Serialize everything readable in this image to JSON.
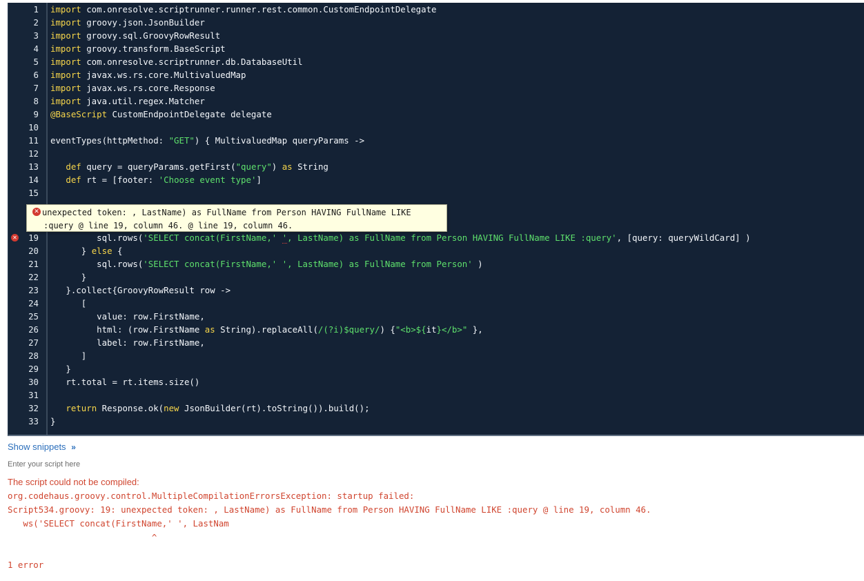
{
  "editor": {
    "lines": [
      {
        "n": "1",
        "segs": [
          {
            "t": "import",
            "c": "kw"
          },
          {
            "t": " com.onresolve.scriptrunner.runner.rest.common.CustomEndpointDelegate"
          }
        ]
      },
      {
        "n": "2",
        "segs": [
          {
            "t": "import",
            "c": "kw"
          },
          {
            "t": " groovy.json.JsonBuilder"
          }
        ]
      },
      {
        "n": "3",
        "segs": [
          {
            "t": "import",
            "c": "kw"
          },
          {
            "t": " groovy.sql.GroovyRowResult"
          }
        ]
      },
      {
        "n": "4",
        "segs": [
          {
            "t": "import",
            "c": "kw"
          },
          {
            "t": " groovy.transform.BaseScript"
          }
        ]
      },
      {
        "n": "5",
        "segs": [
          {
            "t": "import",
            "c": "kw"
          },
          {
            "t": " com.onresolve.scriptrunner.db.DatabaseUtil"
          }
        ]
      },
      {
        "n": "6",
        "segs": [
          {
            "t": "import",
            "c": "kw"
          },
          {
            "t": " javax.ws.rs.core.MultivaluedMap"
          }
        ]
      },
      {
        "n": "7",
        "segs": [
          {
            "t": "import",
            "c": "kw"
          },
          {
            "t": " javax.ws.rs.core.Response"
          }
        ]
      },
      {
        "n": "8",
        "segs": [
          {
            "t": "import",
            "c": "kw"
          },
          {
            "t": " java.util.regex.Matcher"
          }
        ]
      },
      {
        "n": "9",
        "segs": [
          {
            "t": "@BaseScript",
            "c": "ann"
          },
          {
            "t": " CustomEndpointDelegate delegate"
          }
        ]
      },
      {
        "n": "10",
        "segs": []
      },
      {
        "n": "11",
        "segs": [
          {
            "t": "eventTypes(httpMethod: "
          },
          {
            "t": "\"GET\"",
            "c": "str"
          },
          {
            "t": ") { MultivaluedMap queryParams ->"
          }
        ]
      },
      {
        "n": "12",
        "segs": []
      },
      {
        "n": "13",
        "segs": [
          {
            "t": "   "
          },
          {
            "t": "def",
            "c": "kw"
          },
          {
            "t": " query = queryParams.getFirst("
          },
          {
            "t": "\"query\"",
            "c": "str"
          },
          {
            "t": ") "
          },
          {
            "t": "as",
            "c": "kw"
          },
          {
            "t": " String"
          }
        ]
      },
      {
        "n": "14",
        "segs": [
          {
            "t": "   "
          },
          {
            "t": "def",
            "c": "kw"
          },
          {
            "t": " rt = [footer: "
          },
          {
            "t": "'Choose event type'",
            "c": "str"
          },
          {
            "t": "]"
          }
        ]
      },
      {
        "n": "15",
        "segs": []
      },
      {
        "n": "19",
        "error": true,
        "segs": [
          {
            "t": "         sql.rows("
          },
          {
            "t": "'SELECT concat(FirstName,' ",
            "c": "str"
          },
          {
            "t": "'",
            "c": "str sqg"
          },
          {
            "t": ", LastName) as FullName from Person HAVING FullName LIKE :query'",
            "c": "str"
          },
          {
            "t": ", [query: queryWildCard] )"
          }
        ]
      },
      {
        "n": "20",
        "segs": [
          {
            "t": "      } "
          },
          {
            "t": "else",
            "c": "kw"
          },
          {
            "t": " {"
          }
        ]
      },
      {
        "n": "21",
        "segs": [
          {
            "t": "         sql.rows("
          },
          {
            "t": "'SELECT concat(FirstName,' ', LastName) as FullName from Person'",
            "c": "str"
          },
          {
            "t": " )"
          }
        ]
      },
      {
        "n": "22",
        "segs": [
          {
            "t": "      }"
          }
        ]
      },
      {
        "n": "23",
        "segs": [
          {
            "t": "   }.collect{GroovyRowResult row ->"
          }
        ]
      },
      {
        "n": "24",
        "segs": [
          {
            "t": "      ["
          }
        ]
      },
      {
        "n": "25",
        "segs": [
          {
            "t": "         value: row.FirstName,"
          }
        ]
      },
      {
        "n": "26",
        "segs": [
          {
            "t": "         html: (row.FirstName "
          },
          {
            "t": "as",
            "c": "kw"
          },
          {
            "t": " String).replaceAll("
          },
          {
            "t": "/(?i)$query/",
            "c": "str"
          },
          {
            "t": ") {"
          },
          {
            "t": "\"<b>${",
            "c": "str"
          },
          {
            "t": "it"
          },
          {
            "t": "}</b>\"",
            "c": "str"
          },
          {
            "t": " },"
          }
        ]
      },
      {
        "n": "27",
        "segs": [
          {
            "t": "         label: row.FirstName,"
          }
        ]
      },
      {
        "n": "28",
        "segs": [
          {
            "t": "      ]"
          }
        ]
      },
      {
        "n": "29",
        "segs": [
          {
            "t": "   }"
          }
        ]
      },
      {
        "n": "30",
        "segs": [
          {
            "t": "   rt.total = rt.items.size()"
          }
        ]
      },
      {
        "n": "31",
        "segs": []
      },
      {
        "n": "32",
        "segs": [
          {
            "t": "   "
          },
          {
            "t": "return",
            "c": "kw"
          },
          {
            "t": " Response.ok("
          },
          {
            "t": "new",
            "c": "kw"
          },
          {
            "t": " JsonBuilder(rt).toString()).build();"
          }
        ]
      },
      {
        "n": "33",
        "segs": [
          {
            "t": "}"
          }
        ]
      }
    ],
    "tooltip": {
      "icon": "error-icon",
      "line1": "unexpected token: , LastName) as FullName from Person HAVING FullName LIKE",
      "line2": ":query @ line 19, column 46. @ line 19, column 46."
    }
  },
  "snippets": {
    "label": "Show snippets",
    "icon": "double-chevron-down-icon"
  },
  "hint": "Enter your script here",
  "errors": {
    "title": "The script could not be compiled:",
    "lines": [
      "org.codehaus.groovy.control.MultipleCompilationErrorsException: startup failed:",
      "Script534.groovy: 19: unexpected token: , LastName) as FullName from Person HAVING FullName LIKE :query @ line 19, column 46.",
      "   ws('SELECT concat(FirstName,' ', LastNam",
      "                            ^"
    ],
    "count": "1 error"
  },
  "colors": {
    "editor_bg": "#142235",
    "keyword": "#f7d64b",
    "string": "#5ee06c",
    "error_text": "#d0452f",
    "link": "#2a6ebb"
  }
}
